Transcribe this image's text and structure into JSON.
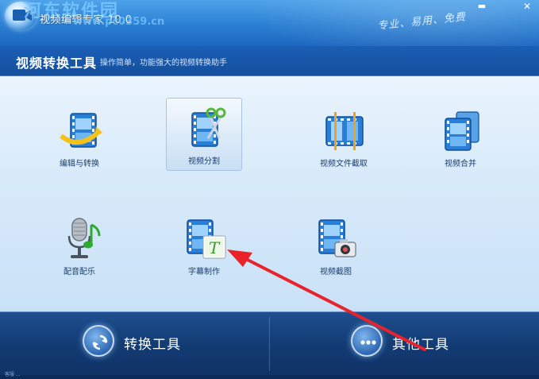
{
  "window": {
    "title": "视频编辑专家 10.0",
    "slogan": "专业、易用、免费",
    "minimize_glyph": "▬",
    "close_glyph": "✕"
  },
  "watermark": {
    "text": "河东软件园",
    "url": "www.pc0359.cn"
  },
  "header": {
    "title": "视频转换工具",
    "subtitle": "操作简单，功能强大的视频转换助手"
  },
  "tools": [
    {
      "id": "edit-convert",
      "label": "编辑与转换",
      "icon": "film-arrow-icon",
      "selected": false
    },
    {
      "id": "split",
      "label": "视频分割",
      "icon": "film-scissors-icon",
      "selected": true
    },
    {
      "id": "crop",
      "label": "视频文件截取",
      "icon": "film-crop-icon",
      "selected": false
    },
    {
      "id": "merge",
      "label": "视频合并",
      "icon": "film-stack-icon",
      "selected": false
    },
    {
      "id": "dub",
      "label": "配音配乐",
      "icon": "microphone-music-icon",
      "selected": false
    },
    {
      "id": "subtitle",
      "label": "字幕制作",
      "icon": "film-subtitle-icon",
      "selected": false
    },
    {
      "id": "screenshot",
      "label": "视频截图",
      "icon": "film-camera-icon",
      "selected": false
    }
  ],
  "bottom": {
    "convert_label": "转换工具",
    "other_label": "其他工具",
    "convert_icon": "refresh-icon",
    "other_icon": "more-dots-icon"
  },
  "status": {
    "text": "客服  ..."
  },
  "colors": {
    "accent": "#1c67c0",
    "panel": "#d9ebfa",
    "annotation_arrow": "#e8232a"
  }
}
